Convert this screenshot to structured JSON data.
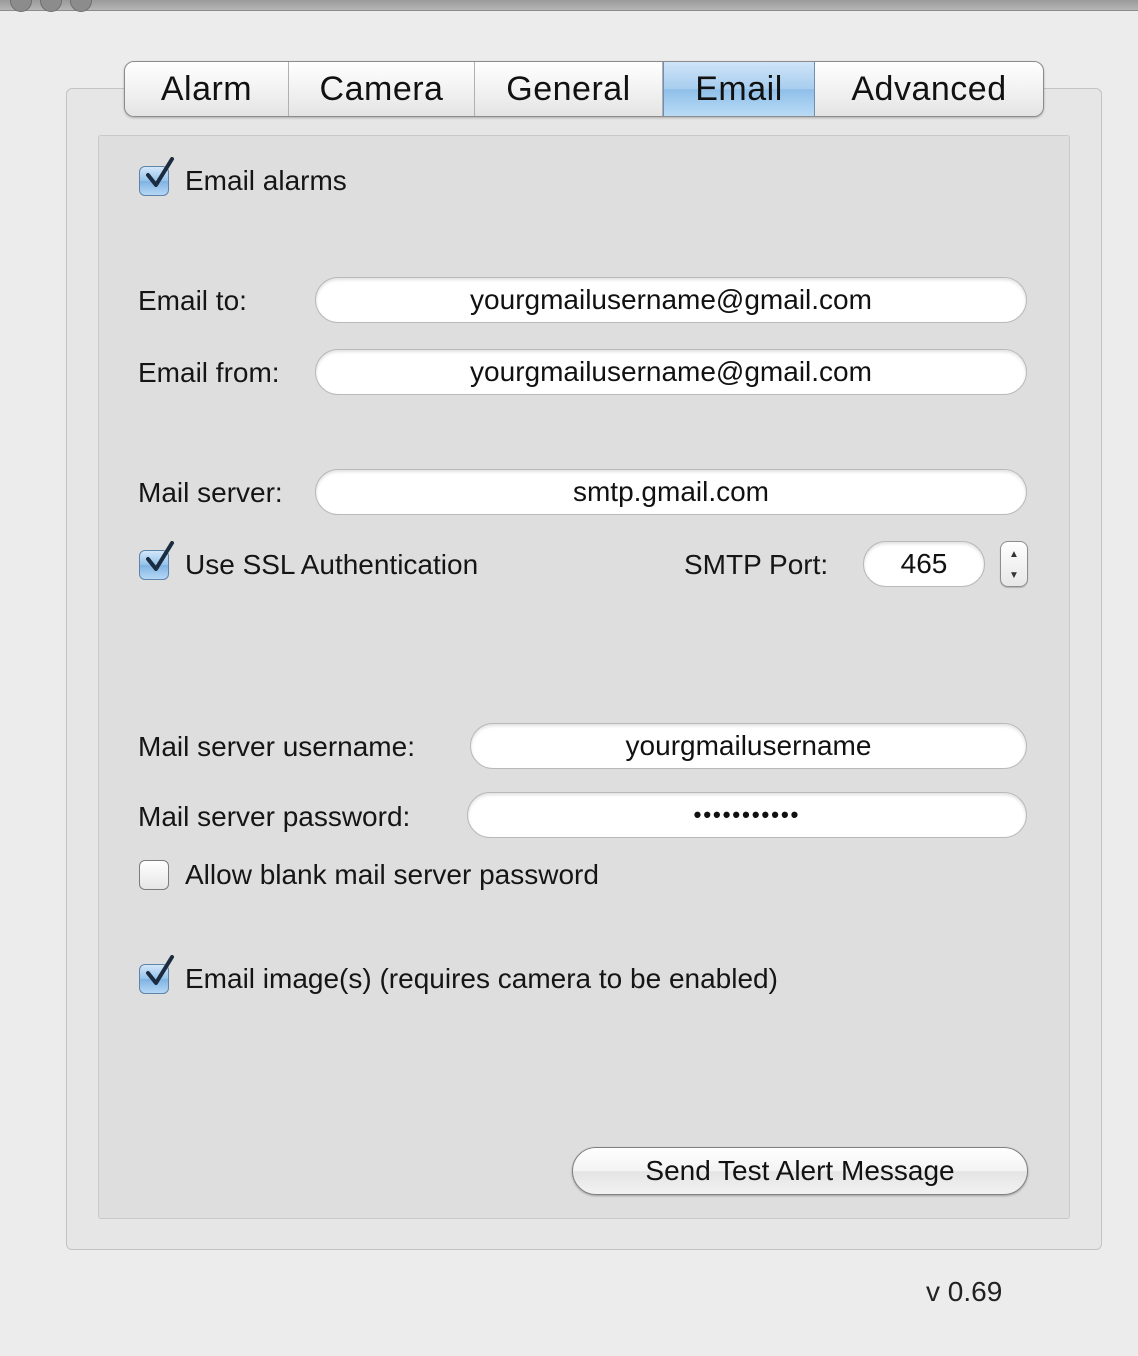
{
  "tabs": [
    {
      "label": "Alarm"
    },
    {
      "label": "Camera"
    },
    {
      "label": "General"
    },
    {
      "label": "Email"
    },
    {
      "label": "Advanced"
    }
  ],
  "selected_tab": "Email",
  "email_alarms": {
    "label": "Email alarms",
    "checked": true
  },
  "email_to": {
    "label": "Email to:",
    "value": "yourgmailusername@gmail.com"
  },
  "email_from": {
    "label": "Email from:",
    "value": "yourgmailusername@gmail.com"
  },
  "mail_server": {
    "label": "Mail server:",
    "value": "smtp.gmail.com"
  },
  "use_ssl": {
    "label": "Use SSL Authentication",
    "checked": true
  },
  "smtp_port": {
    "label": "SMTP Port:",
    "value": "465"
  },
  "username": {
    "label": "Mail server username:",
    "value": "yourgmailusername"
  },
  "password": {
    "label": "Mail server password:",
    "value": "•••••••••••"
  },
  "allow_blank": {
    "label": "Allow blank mail server password",
    "checked": false
  },
  "email_images": {
    "label": "Email image(s) (requires camera to be enabled)",
    "checked": true
  },
  "send_test_button": "Send Test Alert Message",
  "version": "v 0.69",
  "colors": {
    "selected_tab": "#a7cdee",
    "checkbox_checked": "#94c2ea",
    "background": "#ececec"
  },
  "icons": {
    "checkmark": "checkmark-icon",
    "stepper_up": "stepper-up-icon",
    "stepper_down": "stepper-down-icon"
  }
}
